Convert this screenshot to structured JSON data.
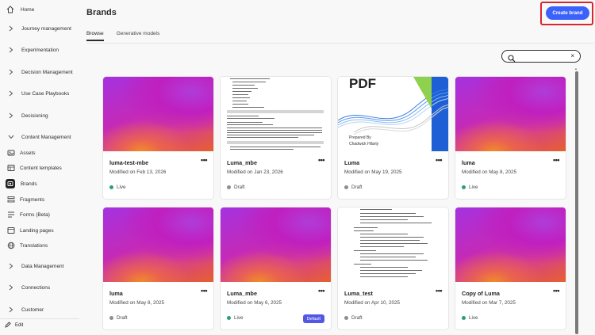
{
  "colors": {
    "accent": "#3b63fb",
    "live": "#2d9d78",
    "draft": "#8e8e8e",
    "default_badge": "#5258e4",
    "highlight_frame": "#d7262e"
  },
  "sidebar": {
    "items": [
      {
        "label": "Home",
        "icon": "home-icon"
      },
      {
        "label": "Journey management",
        "icon": "chevron-right-icon"
      },
      {
        "label": "Experimentation",
        "icon": "chevron-right-icon"
      },
      {
        "label": "Decision Management",
        "icon": "chevron-right-icon"
      },
      {
        "label": "Use Case Playbooks",
        "icon": "chevron-right-icon"
      },
      {
        "label": "Decisioning",
        "icon": "chevron-right-icon"
      },
      {
        "label": "Content Management",
        "icon": "chevron-down-icon"
      },
      {
        "label": "Assets",
        "icon": "assets-icon"
      },
      {
        "label": "Content templates",
        "icon": "templates-icon"
      },
      {
        "label": "Brands",
        "icon": "brands-icon"
      },
      {
        "label": "Fragments",
        "icon": "fragments-icon"
      },
      {
        "label": "Forms (Beta)",
        "icon": "forms-icon"
      },
      {
        "label": "Landing pages",
        "icon": "landing-pages-icon"
      },
      {
        "label": "Translations",
        "icon": "globe-icon"
      },
      {
        "label": "Data Management",
        "icon": "chevron-right-icon"
      },
      {
        "label": "Connections",
        "icon": "chevron-right-icon"
      },
      {
        "label": "Customer",
        "icon": "chevron-right-icon"
      }
    ],
    "edit_label": "Edit"
  },
  "header": {
    "title": "Brands",
    "create_button": "Create brand"
  },
  "tabs": [
    {
      "label": "Browse"
    },
    {
      "label": "Generative models"
    }
  ],
  "search": {
    "placeholder": "",
    "clear": "×"
  },
  "cards": [
    {
      "name": "luma-test-mbe",
      "modified": "Modified on Feb 13, 2026",
      "status": "Live"
    },
    {
      "name": "Luma_mbe",
      "modified": "Modified on Jan 23, 2026",
      "status": "Draft"
    },
    {
      "name": "Luma",
      "modified": "Modified on May 19, 2025",
      "status": "Draft"
    },
    {
      "name": "luma",
      "modified": "Modified on May 8, 2025",
      "status": "Live"
    },
    {
      "name": "luma",
      "modified": "Modified on May 8, 2025",
      "status": "Draft"
    },
    {
      "name": "Luma_mbe",
      "modified": "Modified on May 6, 2025",
      "status": "Live",
      "badge": "Default"
    },
    {
      "name": "Luma_test",
      "modified": "Modified on Apr 10, 2025",
      "status": "Draft"
    },
    {
      "name": "Copy of Luma",
      "modified": "Modified on Mar 7, 2025",
      "status": "Live"
    }
  ],
  "pdf_thumb": {
    "heading": "PDF",
    "prepared_by": "Prepared By",
    "author": "Chadwick Hilarty"
  },
  "more_glyph": "•••"
}
